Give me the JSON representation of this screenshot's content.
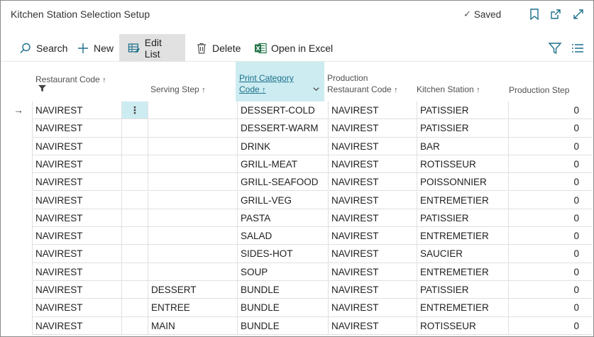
{
  "window": {
    "title": "Kitchen Station Selection Setup",
    "saved_label": "Saved"
  },
  "actions": {
    "search": "Search",
    "new": "New",
    "edit_list": "Edit List",
    "delete": "Delete",
    "open_excel": "Open in Excel"
  },
  "columns": {
    "restaurant_code": "Restaurant Code",
    "serving_step": "Serving Step",
    "print_category_code_l1": "Print Category",
    "print_category_code_l2": "Code",
    "production_restaurant_code_l1": "Production",
    "production_restaurant_code_l2": "Restaurant Code",
    "kitchen_station": "Kitchen Station",
    "production_step": "Production Step"
  },
  "rows": [
    {
      "restaurant": "NAVIREST",
      "serving": "",
      "print": "DESSERT-COLD",
      "prod_rest": "NAVIREST",
      "station": "PATISSIER",
      "step": "0"
    },
    {
      "restaurant": "NAVIREST",
      "serving": "",
      "print": "DESSERT-WARM",
      "prod_rest": "NAVIREST",
      "station": "PATISSIER",
      "step": "0"
    },
    {
      "restaurant": "NAVIREST",
      "serving": "",
      "print": "DRINK",
      "prod_rest": "NAVIREST",
      "station": "BAR",
      "step": "0"
    },
    {
      "restaurant": "NAVIREST",
      "serving": "",
      "print": "GRILL-MEAT",
      "prod_rest": "NAVIREST",
      "station": "ROTISSEUR",
      "step": "0"
    },
    {
      "restaurant": "NAVIREST",
      "serving": "",
      "print": "GRILL-SEAFOOD",
      "prod_rest": "NAVIREST",
      "station": "POISSONNIER",
      "step": "0"
    },
    {
      "restaurant": "NAVIREST",
      "serving": "",
      "print": "GRILL-VEG",
      "prod_rest": "NAVIREST",
      "station": "ENTREMETIER",
      "step": "0"
    },
    {
      "restaurant": "NAVIREST",
      "serving": "",
      "print": "PASTA",
      "prod_rest": "NAVIREST",
      "station": "PATISSIER",
      "step": "0"
    },
    {
      "restaurant": "NAVIREST",
      "serving": "",
      "print": "SALAD",
      "prod_rest": "NAVIREST",
      "station": "ENTREMETIER",
      "step": "0"
    },
    {
      "restaurant": "NAVIREST",
      "serving": "",
      "print": "SIDES-HOT",
      "prod_rest": "NAVIREST",
      "station": "SAUCIER",
      "step": "0"
    },
    {
      "restaurant": "NAVIREST",
      "serving": "",
      "print": "SOUP",
      "prod_rest": "NAVIREST",
      "station": "ENTREMETIER",
      "step": "0"
    },
    {
      "restaurant": "NAVIREST",
      "serving": "DESSERT",
      "print": "BUNDLE",
      "prod_rest": "NAVIREST",
      "station": "PATISSIER",
      "step": "0"
    },
    {
      "restaurant": "NAVIREST",
      "serving": "ENTREE",
      "print": "BUNDLE",
      "prod_rest": "NAVIREST",
      "station": "ENTREMETIER",
      "step": "0"
    },
    {
      "restaurant": "NAVIREST",
      "serving": "MAIN",
      "print": "BUNDLE",
      "prod_rest": "NAVIREST",
      "station": "ROTISSEUR",
      "step": "0"
    }
  ],
  "icons": {
    "bookmark": "bookmark-icon",
    "popout": "popout-icon",
    "expand": "expand-icon",
    "filter": "filter-icon",
    "list": "list-view-icon",
    "excel": "excel-icon"
  },
  "colors": {
    "accent": "#1b6f8a",
    "selected_header": "#cdecf1",
    "excel_green": "#1e7145"
  }
}
